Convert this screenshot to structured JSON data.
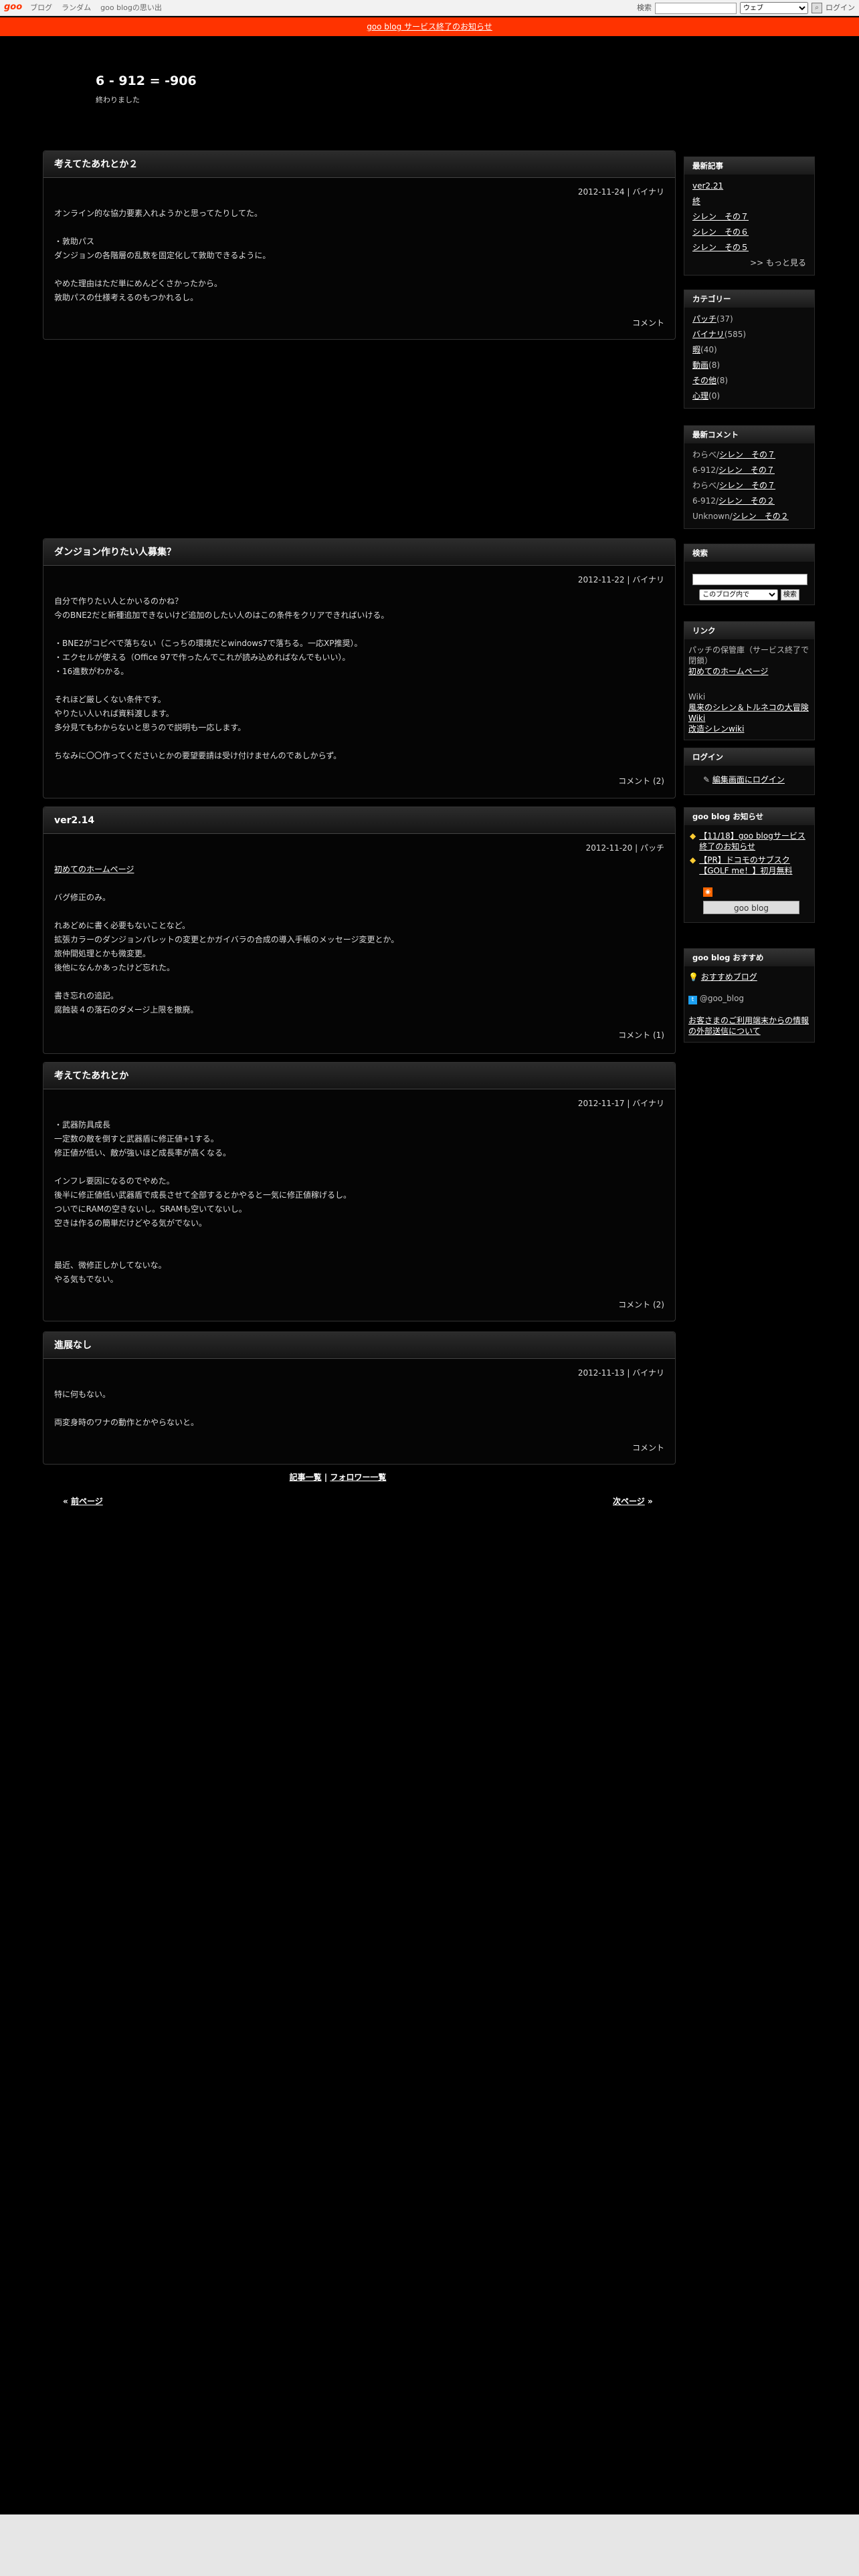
{
  "topbar": {
    "logo": "goo",
    "nav": [
      "ブログ",
      "ランダム",
      "goo blogの思い出"
    ],
    "search_label": "検索",
    "search_placeholder": "",
    "select_value": "ウェブ",
    "login": "ログイン"
  },
  "notice": "goo blog サービス終了のお知らせ",
  "blog": {
    "title": "6 - 912 = -906",
    "description": "終わりました"
  },
  "entries": [
    {
      "title": "考えてたあれとか２",
      "meta": "2012-11-24 | バイナリ",
      "lines": [
        "オンライン的な協力要素入れようかと思ってたりしてた。",
        "",
        "・敦助パス",
        "ダンジョンの各階層の乱数を固定化して敦助できるように。",
        "",
        "やめた理由はただ単にめんどくさかったから。",
        "敦助パスの仕様考えるのもつかれるし。"
      ],
      "footer": "コメント"
    },
    {
      "title": "ダンジョン作りたい人募集？",
      "meta": "2012-11-22 | バイナリ",
      "lines": [
        "自分で作りたい人とかいるのかね？",
        "今のBNE2だと新種追加できないけど追加のしたい人のはこの条件をクリアできればいける。",
        "",
        "・BNE2がコピペで落ちない（こっちの環境だとwindows7で落ちる。一応XP推奨）。",
        "・エクセルが使える（Office 97で作ったんでこれが読み込めればなんでもいい）。",
        "・16進数がわかる。",
        "",
        "それほど厳しくない条件です。",
        "やりたい人いれば資料渡します。",
        "多分見てもわからないと思うので説明も一応します。",
        "",
        "ちなみに〇〇作ってくださいとかの要望要請は受け付けませんのであしからず。"
      ],
      "footer": "コメント (2)"
    },
    {
      "title": "ver2.14",
      "meta": "2012-11-20 | パッチ",
      "link": "初めてのホームページ",
      "lines": [
        "",
        "バグ修正のみ。",
        "",
        "れあどめに書く必要もないことなど。",
        "拡張カラーのダンジョンパレットの変更とかガイバラの合成の導入手帳のメッセージ変更とか。",
        "旅仲間処理とかも微変更。",
        "後他になんかあったけど忘れた。",
        "",
        "書き忘れの追記。",
        "腐蝕装４の落石のダメージ上限を撤廃。"
      ],
      "footer": "コメント (1)"
    },
    {
      "title": "考えてたあれとか",
      "meta": "2012-11-17 | バイナリ",
      "lines": [
        "・武器防具成長",
        "一定数の敵を倒すと武器盾に修正値+1する。",
        "修正値が低い、敵が強いほど成長率が高くなる。",
        "",
        "インフレ要因になるのでやめた。",
        "後半に修正値低い武器盾で成長させて全部するとかやると一気に修正値稼げるし。",
        "ついでにRAMの空きないし。SRAMも空いてないし。",
        "空きは作るの簡単だけどやる気がでない。",
        "",
        "",
        "最近、微修正しかしてないな。",
        "やる気もでない。"
      ],
      "footer": "コメント (2)"
    },
    {
      "title": "進展なし",
      "meta": "2012-11-13 | バイナリ",
      "lines": [
        "特に何もない。",
        "",
        "両変身時のワナの動作とかやらないと。"
      ],
      "footer": "コメント"
    }
  ],
  "pager": {
    "list": "記事一覧",
    "sep": " | ",
    "follow": "フォロワー一覧",
    "prev": "前ページ",
    "next": "次ページ",
    "prev_prefix": "« ",
    "next_suffix": " »"
  },
  "sidebar": {
    "recent": {
      "title": "最新記事",
      "items": [
        "ver2.21",
        "終",
        "シレン　その７",
        "シレン　その６",
        "シレン　その５"
      ],
      "more": ">> もっと見る"
    },
    "categories": {
      "title": "カテゴリー",
      "items": [
        {
          "name": "パッチ",
          "count": "(37)"
        },
        {
          "name": "バイナリ",
          "count": "(585)"
        },
        {
          "name": "暇",
          "count": "(40)"
        },
        {
          "name": "動画",
          "count": "(8)"
        },
        {
          "name": "その他",
          "count": "(8)"
        },
        {
          "name": "心理",
          "count": "(0)"
        }
      ]
    },
    "comments": {
      "title": "最新コメント",
      "items": [
        {
          "user": "わらべ/",
          "post": "シレン　その７"
        },
        {
          "user": "6-912/",
          "post": "シレン　その７"
        },
        {
          "user": "わらべ/",
          "post": "シレン　その７"
        },
        {
          "user": "6-912/",
          "post": "シレン　その２"
        },
        {
          "user": "Unknown/",
          "post": "シレン　その２"
        }
      ]
    },
    "search": {
      "title": "検索",
      "scope": "このブログ内で",
      "button": "検索"
    },
    "links": {
      "title": "リンク",
      "intro": "パッチの保管庫（サービス終了で閉鎖）",
      "homepage": "初めてのホームページ",
      "wiki_label": "Wiki",
      "wiki1": "風来のシレン＆トルネコの大冒険 Wiki",
      "wiki2": "改造シレンwiki"
    },
    "login": {
      "title": "ログイン",
      "link": "編集画面にログイン"
    },
    "goo_notice": {
      "title": "goo blog お知らせ",
      "items": [
        "【11/18】goo blogサービス終了のお知らせ",
        "【PR】ドコモのサブスク【GOLF me！】初月無料"
      ],
      "badge": "goo blog"
    },
    "recommend": {
      "title": "goo blog おすすめ",
      "item": "おすすめブログ",
      "twitter": "@goo_blog",
      "ext": "お客さまのご利用端末からの情報の外部送信について"
    }
  },
  "colors": {
    "accent": "#ff3300",
    "background": "#000000",
    "footer": "#e6e6e6"
  }
}
